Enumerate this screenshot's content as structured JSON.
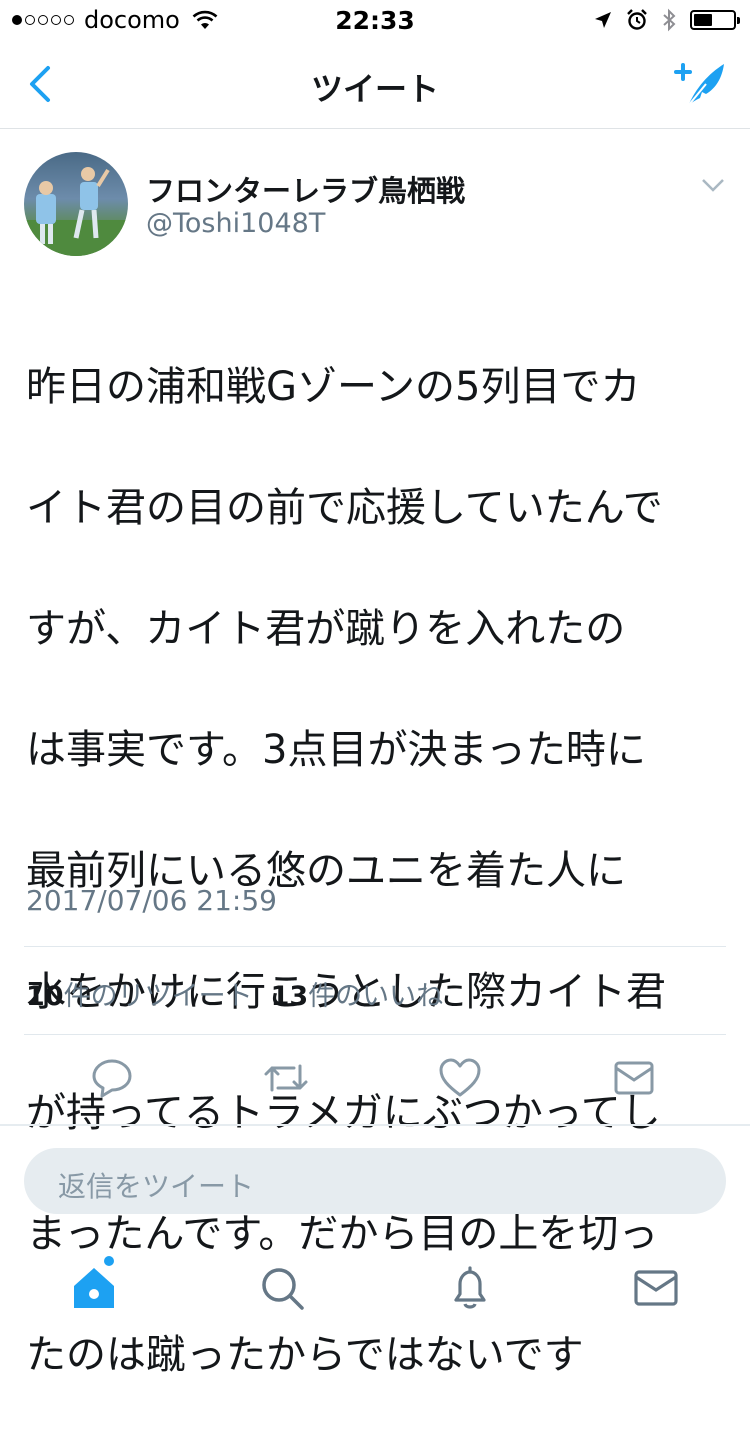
{
  "status_bar": {
    "carrier": "docomo",
    "time": "22:33"
  },
  "nav": {
    "title": "ツイート"
  },
  "tweet": {
    "display_name": "フロンターレラブ鳥栖戦",
    "handle": "@Toshi1048T",
    "text_lines": [
      "昨日の浦和戦Gゾーンの5列目でカ",
      "イト君の目の前で応援していたんで",
      "すが、カイト君が蹴りを入れたの",
      "は事実です。3点目が決まった時に",
      "最前列にいる悠のユニを着た人に",
      "水をかけに行こうとした際カイト君",
      "が持ってるトラメガにぶつかってし",
      "まったんです。だから目の上を切っ",
      "たのは蹴ったからではないです"
    ],
    "timestamp": "2017/07/06 21:59",
    "retweet_count": "10",
    "retweet_label": "件のリツイート",
    "like_count": "13",
    "like_label": "件のいいね"
  },
  "reply": {
    "placeholder": "返信をツイート"
  },
  "colors": {
    "accent": "#1da1f2",
    "secondary_text": "#657786",
    "icon_gray": "#8899a6"
  }
}
